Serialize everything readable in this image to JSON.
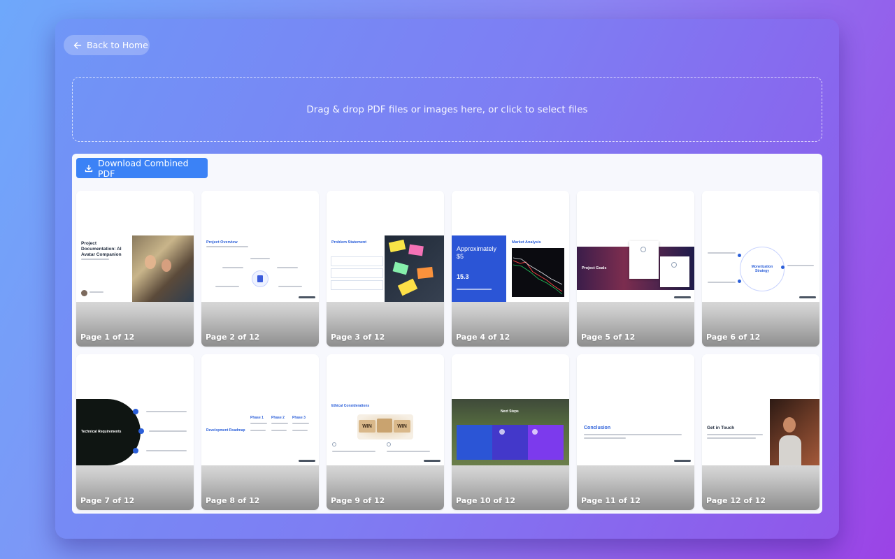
{
  "nav": {
    "back_label": "Back to Home"
  },
  "dropzone": {
    "text": "Drag & drop PDF files or images here, or click to select files"
  },
  "toolbar": {
    "download_label": "Download Combined PDF"
  },
  "colors": {
    "accent": "#3b82f6",
    "slide_blue": "#2b5fd9",
    "slide_navy": "#1e3a8a"
  },
  "icons": {
    "back": "arrow-left-icon",
    "download": "download-icon"
  },
  "pages": [
    {
      "label": "Page 1 of 12",
      "title": "Project Documentation: AI Avatar Companion"
    },
    {
      "label": "Page 2 of 12",
      "title": "Project Overview"
    },
    {
      "label": "Page 3 of 12",
      "title": "Problem Statement"
    },
    {
      "label": "Page 4 of 12",
      "title": "Market Analysis",
      "highlight": "Approximately $5",
      "stat": "15.3"
    },
    {
      "label": "Page 5 of 12",
      "title": "Project Goals"
    },
    {
      "label": "Page 6 of 12",
      "title": "Monetization Strategy"
    },
    {
      "label": "Page 7 of 12",
      "title": "Technical Requirements"
    },
    {
      "label": "Page 8 of 12",
      "title": "Development Roadmap",
      "phases": [
        "Phase 1",
        "Phase 2",
        "Phase 3"
      ]
    },
    {
      "label": "Page 9 of 12",
      "title": "Ethical Considerations",
      "tiles": [
        "WIN",
        "WIN"
      ]
    },
    {
      "label": "Page 10 of 12",
      "title": "Next Steps"
    },
    {
      "label": "Page 11 of 12",
      "title": "Conclusion"
    },
    {
      "label": "Page 12 of 12",
      "title": "Get in Touch"
    }
  ]
}
